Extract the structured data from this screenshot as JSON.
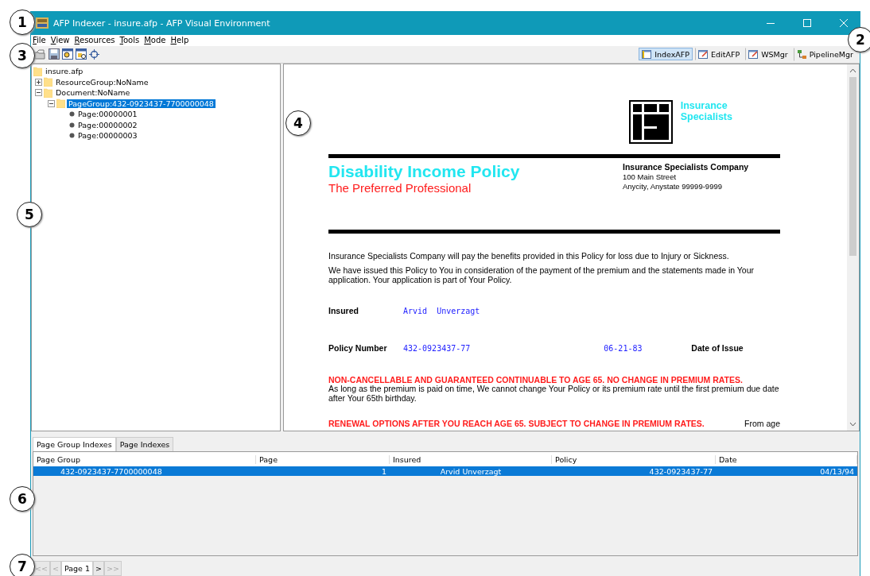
{
  "window": {
    "title": "AFP Indexer - insure.afp - AFP Visual Environment"
  },
  "menu": [
    "File",
    "View",
    "Resources",
    "Tools",
    "Mode",
    "Help"
  ],
  "modes": [
    {
      "label": "IndexAFP",
      "selected": true
    },
    {
      "label": "EditAFP",
      "selected": false
    },
    {
      "label": "WSMgr",
      "selected": false
    },
    {
      "label": "PipelineMgr",
      "selected": false
    }
  ],
  "tree": {
    "label": "insure.afp",
    "kind": "folder",
    "selected": false,
    "children": [
      {
        "label": "ResourceGroup:NoName",
        "kind": "folder",
        "expanded": false,
        "selected": false
      },
      {
        "label": "Document:NoName",
        "kind": "folder",
        "expanded": true,
        "selected": false,
        "children": [
          {
            "label": "PageGroup:432-0923437-7700000048",
            "kind": "folder",
            "expanded": true,
            "selected": true,
            "children": [
              {
                "label": "Page:00000001",
                "kind": "page",
                "selected": false
              },
              {
                "label": "Page:00000002",
                "kind": "page",
                "selected": false
              },
              {
                "label": "Page:00000003",
                "kind": "page",
                "selected": false
              }
            ]
          }
        ]
      }
    ]
  },
  "document": {
    "logo_lines": [
      "Insurance",
      "Specialists"
    ],
    "title": "Disability Income Policy",
    "subtitle": "The Preferred Professional",
    "company": "Insurance Specialists Company",
    "address": [
      "100 Main Street",
      "Anycity, Anystate 99999-9999"
    ],
    "paragraphs": [
      "Insurance Specialists Company will pay the benefits provided in this Policy for loss due to Injury or Sickness.",
      "We have issued this Policy to You in consideration of the payment of the premium and the statements made in Your application. Your application is part of Your Policy."
    ],
    "insured": {
      "label": "Insured",
      "value": "Arvid  Unverzagt"
    },
    "policy": {
      "label": "Policy Number",
      "value": "432-0923437-77",
      "date": "06-21-83",
      "date_label": "Date of Issue"
    },
    "notices": [
      {
        "heading": "NON-CANCELLABLE AND GUARANTEED CONTINUABLE TO AGE 65. NO CHANGE IN PREMIUM RATES.",
        "body": "As long as the premium is paid on time, We cannot change Your Policy or its premium rate until the first premium due date after Your 65th birthday."
      },
      {
        "heading": "RENEWAL OPTIONS AFTER YOU REACH AGE 65. SUBJECT TO CHANGE IN PREMIUM RATES.",
        "body": "From age"
      }
    ]
  },
  "tabs": [
    {
      "label": "Page Group Indexes",
      "selected": true
    },
    {
      "label": "Page Indexes",
      "selected": false
    }
  ],
  "table": {
    "columns": [
      "Page Group",
      "Page",
      "Insured",
      "Policy",
      "Date"
    ],
    "rows": [
      {
        "selected": true,
        "cells": [
          "432-0923437-7700000048",
          "1",
          "Arvid Unverzagt",
          "432-0923437-77",
          "04/13/94"
        ]
      }
    ]
  },
  "pager": [
    {
      "label": "<<",
      "disabled": true
    },
    {
      "label": "<",
      "disabled": true
    },
    {
      "label": "Page 1",
      "kind": "field"
    },
    {
      "label": ">",
      "disabled": false
    },
    {
      "label": ">>",
      "disabled": true
    }
  ],
  "callouts": [
    "1",
    "2",
    "3",
    "4",
    "5",
    "6",
    "7"
  ]
}
